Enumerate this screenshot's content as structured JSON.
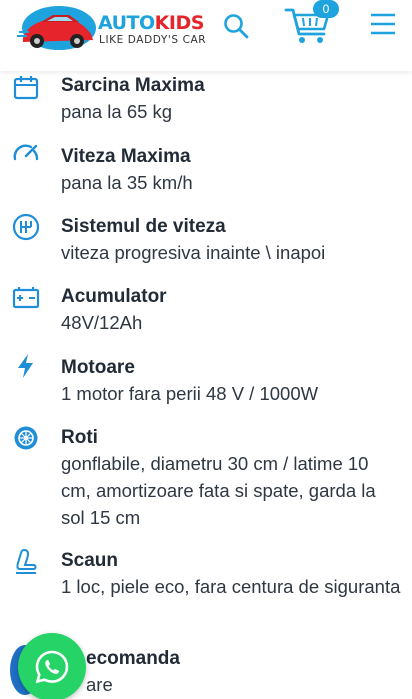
{
  "header": {
    "brand_part1": "AUTO",
    "brand_part2": "KIDS",
    "tagline": "LIKE DADDY'S CAR",
    "cart_count": "0",
    "icons": [
      "car-logo-icon",
      "search-icon",
      "cart-icon",
      "menu-icon"
    ]
  },
  "colors": {
    "accent": "#1fa3de",
    "brand_red": "#e5242b",
    "whatsapp": "#25d366",
    "text": "#222b36"
  },
  "specs": [
    {
      "icon": "calendar-icon",
      "title": "Sarcina Maxima",
      "value": "pana la 65 kg"
    },
    {
      "icon": "speedometer-icon",
      "title": "Viteza Maxima",
      "value": "pana la 35 km/h"
    },
    {
      "icon": "gear-shift-icon",
      "title": "Sistemul de viteza",
      "value": "viteza progresiva inainte \\ inapoi"
    },
    {
      "icon": "battery-icon",
      "title": "Acumulator",
      "value": "48V/12Ah"
    },
    {
      "icon": "lightning-icon",
      "title": "Motoare",
      "value": "1 motor fara perii 48 V / 1000W"
    },
    {
      "icon": "wheel-icon",
      "title": "Roti",
      "value": "gonflabile, diametru 30 cm / latime 10 cm, amortizoare fata si spate, garda la sol 15 cm"
    },
    {
      "icon": "seat-icon",
      "title": "Scaun",
      "value": "1 loc, piele eco, fara centura de siguranta"
    },
    {
      "icon": "remote-icon",
      "title": "ecomanda",
      "value": "are"
    }
  ],
  "whatsapp": {
    "icon": "whatsapp-icon"
  }
}
